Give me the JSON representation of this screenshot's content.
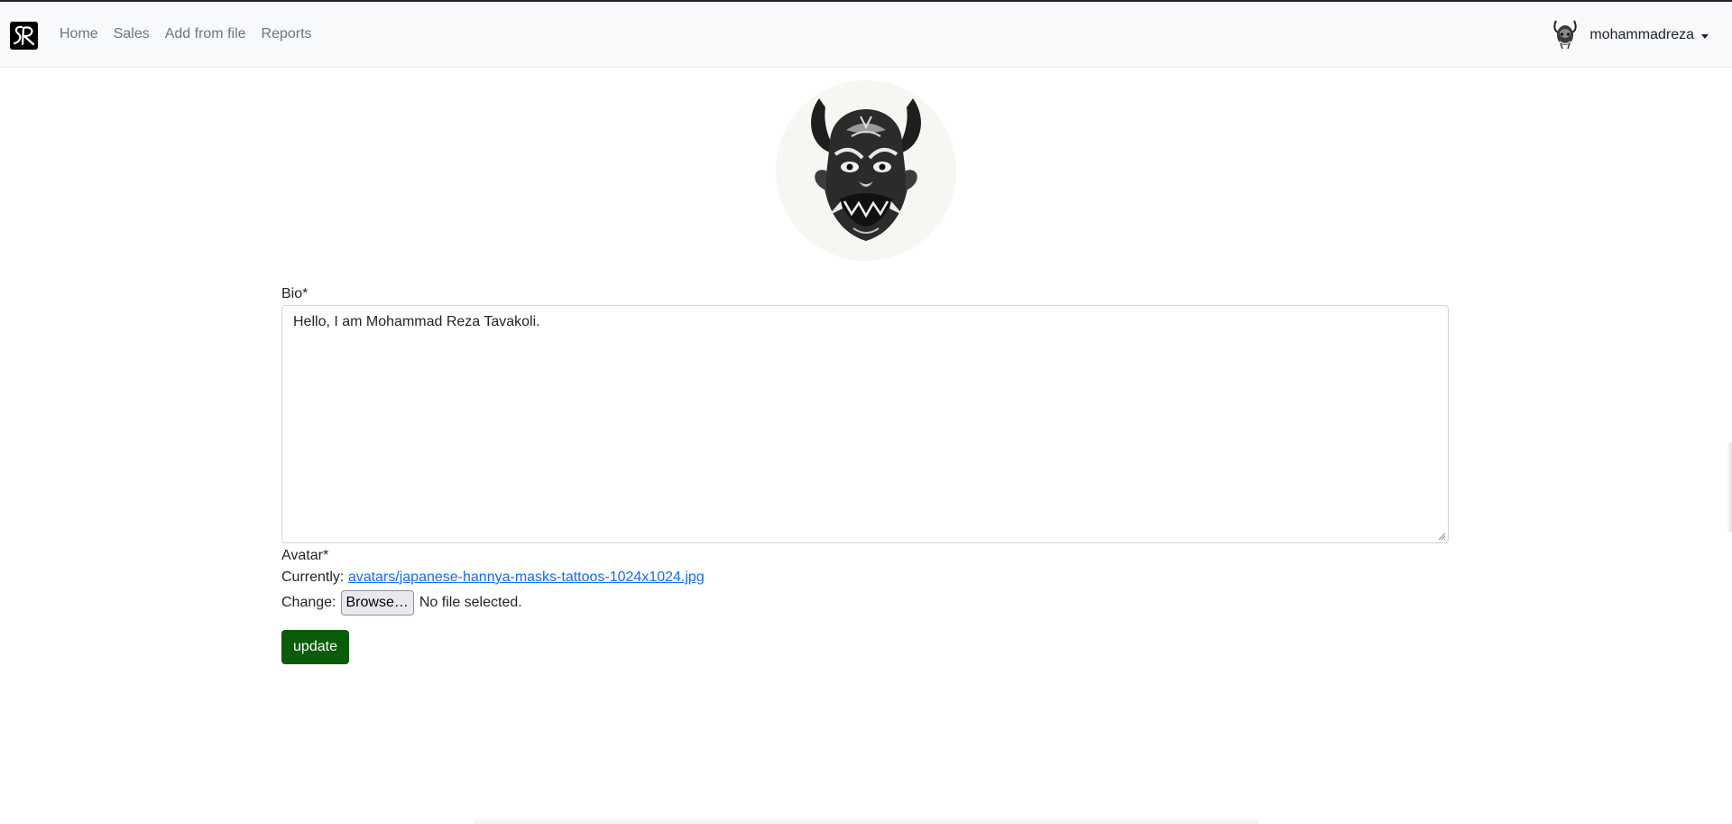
{
  "nav": {
    "brand_icon": "sr-logo-icon",
    "links": [
      "Home",
      "Sales",
      "Add from file",
      "Reports"
    ],
    "user": {
      "name": "mohammadreza",
      "avatar_icon": "hannya-mask-icon"
    }
  },
  "profile": {
    "avatar_icon": "hannya-mask-icon"
  },
  "form": {
    "bio_label": "Bio*",
    "bio_value": "Hello, I am Mohammad Reza Tavakoli.",
    "avatar_label": "Avatar*",
    "currently_label": "Currently:",
    "current_file": "avatars/japanese-hannya-masks-tattoos-1024x1024.jpg",
    "change_label": "Change:",
    "browse_label": "Browse…",
    "no_file_text": "No file selected.",
    "submit_label": "update"
  },
  "colors": {
    "navbar_bg": "#f8f9fa",
    "link": "#0d6efd",
    "submit_bg": "#0a5c0a"
  }
}
